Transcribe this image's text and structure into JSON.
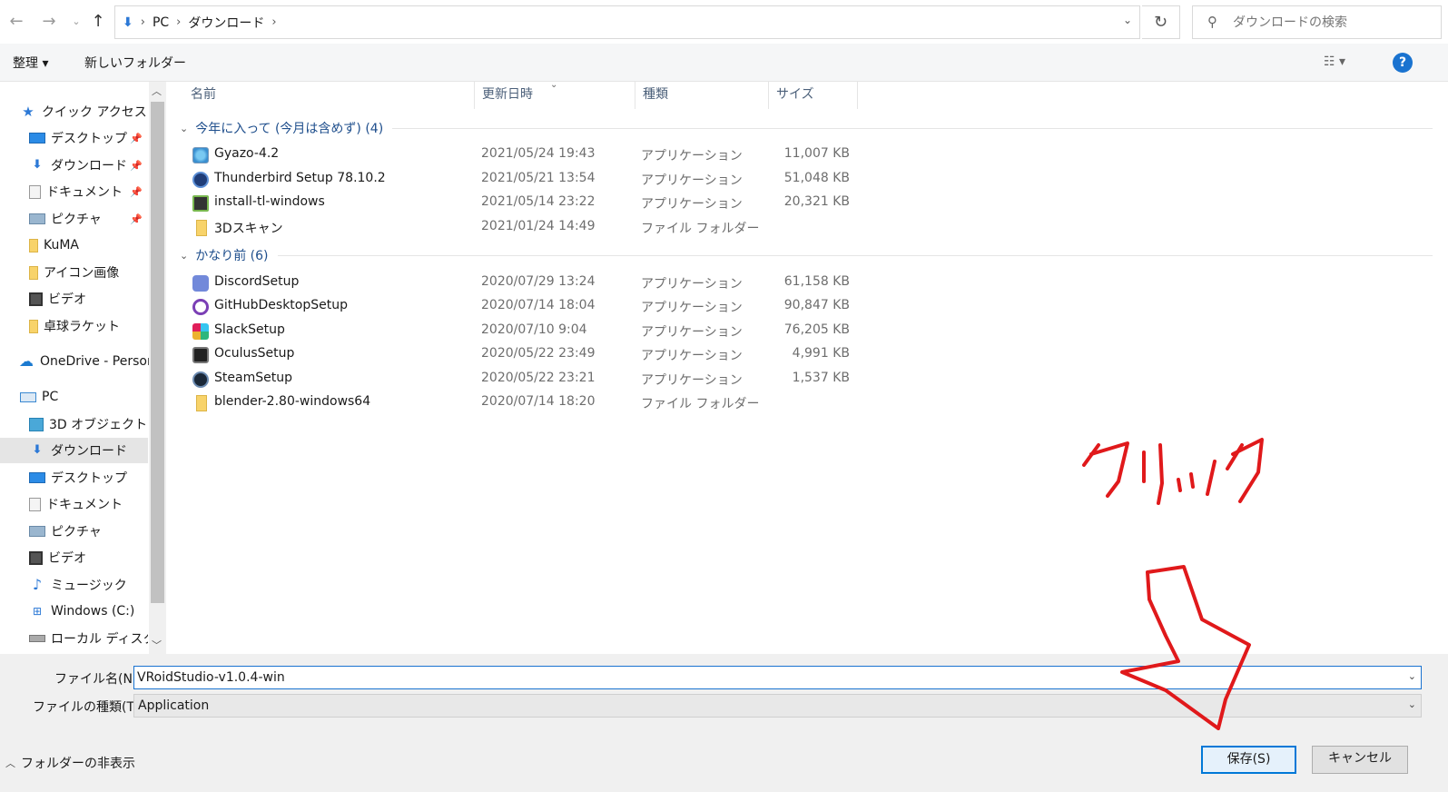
{
  "breadcrumb": {
    "items": [
      "PC",
      "ダウンロード"
    ]
  },
  "search": {
    "placeholder": "ダウンロードの検索"
  },
  "commands": {
    "organize": "整理 ▾",
    "new_folder": "新しいフォルダー"
  },
  "sidebar": {
    "quick_access": "クイック アクセス",
    "items": [
      {
        "label": "デスクトップ",
        "icon": "desktop-icon"
      },
      {
        "label": "ダウンロード",
        "icon": "download-icon"
      },
      {
        "label": "ドキュメント",
        "icon": "document-icon"
      },
      {
        "label": "ピクチャ",
        "icon": "picture-icon"
      },
      {
        "label": "KuMA",
        "icon": "folder-icon"
      },
      {
        "label": "アイコン画像",
        "icon": "folder-icon"
      },
      {
        "label": "ビデオ",
        "icon": "video-icon"
      },
      {
        "label": "卓球ラケット",
        "icon": "folder-icon"
      }
    ],
    "onedrive": "OneDrive - Person",
    "pc": "PC",
    "pc_items": [
      {
        "label": "3D オブジェクト",
        "icon": "3d-objects-icon"
      },
      {
        "label": "ダウンロード",
        "icon": "download-icon"
      },
      {
        "label": "デスクトップ",
        "icon": "desktop-icon"
      },
      {
        "label": "ドキュメント",
        "icon": "document-icon"
      },
      {
        "label": "ピクチャ",
        "icon": "picture-icon"
      },
      {
        "label": "ビデオ",
        "icon": "video-icon"
      },
      {
        "label": "ミュージック",
        "icon": "music-icon"
      },
      {
        "label": "Windows (C:)",
        "icon": "windows-drive-icon"
      },
      {
        "label": "ローカル ディスク (D",
        "icon": "disk-icon"
      }
    ]
  },
  "columns": {
    "name": "名前",
    "date": "更新日時",
    "type": "種類",
    "size": "サイズ"
  },
  "groups": [
    {
      "title": "今年に入って (今月は含めず) (4)",
      "files": [
        {
          "name": "Gyazo-4.2",
          "date": "2021/05/24 19:43",
          "type": "アプリケーション",
          "size": "11,007 KB",
          "icon": "gyazo-icon"
        },
        {
          "name": "Thunderbird Setup 78.10.2",
          "date": "2021/05/21 13:54",
          "type": "アプリケーション",
          "size": "51,048 KB",
          "icon": "thunderbird-icon"
        },
        {
          "name": "install-tl-windows",
          "date": "2021/05/14 23:22",
          "type": "アプリケーション",
          "size": "20,321 KB",
          "icon": "installer-icon"
        },
        {
          "name": "3Dスキャン",
          "date": "2021/01/24 14:49",
          "type": "ファイル フォルダー",
          "size": "",
          "icon": "folder-icon"
        }
      ]
    },
    {
      "title": "かなり前 (6)",
      "files": [
        {
          "name": "DiscordSetup",
          "date": "2020/07/29 13:24",
          "type": "アプリケーション",
          "size": "61,158 KB",
          "icon": "discord-icon"
        },
        {
          "name": "GitHubDesktopSetup",
          "date": "2020/07/14 18:04",
          "type": "アプリケーション",
          "size": "90,847 KB",
          "icon": "github-icon"
        },
        {
          "name": "SlackSetup",
          "date": "2020/07/10 9:04",
          "type": "アプリケーション",
          "size": "76,205 KB",
          "icon": "slack-icon"
        },
        {
          "name": "OculusSetup",
          "date": "2020/05/22 23:49",
          "type": "アプリケーション",
          "size": "4,991 KB",
          "icon": "oculus-icon"
        },
        {
          "name": "SteamSetup",
          "date": "2020/05/22 23:21",
          "type": "アプリケーション",
          "size": "1,537 KB",
          "icon": "steam-icon"
        },
        {
          "name": "blender-2.80-windows64",
          "date": "2020/07/14 18:20",
          "type": "ファイル フォルダー",
          "size": "",
          "icon": "folder-icon"
        }
      ]
    }
  ],
  "footer": {
    "filename_label": "ファイル名(N):",
    "filename_value": "VRoidStudio-v1.0.4-win",
    "filetype_label": "ファイルの種類(T):",
    "filetype_value": "Application",
    "hide_folders": "フォルダーの非表示",
    "save": "保存(S)",
    "cancel": "キャンセル"
  },
  "annotation": {
    "text": "クリック",
    "color": "#e0191b"
  }
}
